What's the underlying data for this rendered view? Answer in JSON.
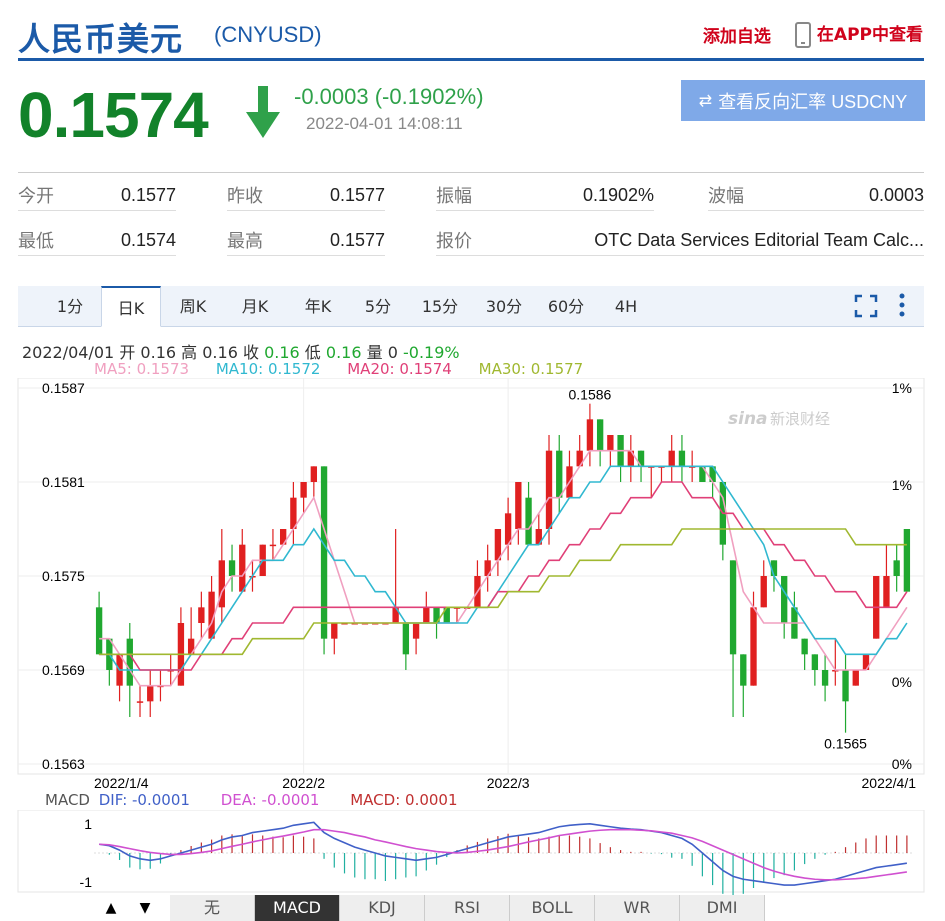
{
  "header": {
    "title": "人民币美元",
    "code": "(CNYUSD)",
    "add_watch": "添加自选",
    "app_view": "在APP中查看"
  },
  "quote": {
    "price": "0.1574",
    "change": "-0.0003 (-0.1902%)",
    "time": "2022-04-01 14:08:11",
    "reverse_button": "查看反向汇率 USDCNY"
  },
  "stats": {
    "row1": [
      {
        "label": "今开",
        "value": "0.1577"
      },
      {
        "label": "昨收",
        "value": "0.1577"
      },
      {
        "label": "振幅",
        "value": "0.1902%"
      },
      {
        "label": "波幅",
        "value": "0.0003"
      }
    ],
    "row2": [
      {
        "label": "最低",
        "value": "0.1574"
      },
      {
        "label": "最高",
        "value": "0.1577"
      },
      {
        "label": "报价",
        "value": "OTC Data Services Editorial Team Calc..."
      }
    ]
  },
  "period_tabs": [
    "1分",
    "日K",
    "周K",
    "月K",
    "年K",
    "5分",
    "15分",
    "30分",
    "60分",
    "4H"
  ],
  "active_tab": "日K",
  "ohlc_line": {
    "date": "2022/04/01",
    "open_label": "开",
    "open": "0.16",
    "high_label": "高",
    "high": "0.16",
    "close_label": "收",
    "close": "0.16",
    "low_label": "低",
    "low": "0.16",
    "vol_label": "量",
    "vol": "0",
    "change": "-0.19%"
  },
  "ma_legend": {
    "ma5": "MA5: 0.1573",
    "ma10": "MA10: 0.1572",
    "ma20": "MA20: 0.1574",
    "ma30": "MA30: 0.1577"
  },
  "colors": {
    "up": "#e02020",
    "down": "#20a830",
    "ma5": "#f0a0c0",
    "ma10": "#30b8d0",
    "ma20": "#e04078",
    "ma30": "#a0b830",
    "dif": "#4060c8",
    "dea": "#d050d0"
  },
  "chart_data": {
    "type": "candlestick",
    "y_ticks": [
      "0.1587",
      "0.1581",
      "0.1575",
      "0.1569",
      "0.1563"
    ],
    "ylim": [
      0.1563,
      0.1587
    ],
    "pct_ticks": [
      "1%",
      "1%",
      "0%",
      "0%"
    ],
    "x_ticks": [
      "2022/1/4",
      "2022/2",
      "2022/3",
      "2022/4/1"
    ],
    "max_label": "0.1586",
    "min_label": "0.1565",
    "candles": [
      [
        0.1573,
        0.157,
        0.1574,
        0.157
      ],
      [
        0.1571,
        0.1569,
        0.1571,
        0.1568
      ],
      [
        0.1568,
        0.157,
        0.157,
        0.1567
      ],
      [
        0.1571,
        0.1568,
        0.1572,
        0.1566
      ],
      [
        0.1567,
        0.1567,
        0.1568,
        0.1566
      ],
      [
        0.1567,
        0.1568,
        0.1569,
        0.1566
      ],
      [
        0.1568,
        0.1568,
        0.1569,
        0.1567
      ],
      [
        0.1569,
        0.1569,
        0.157,
        0.1568
      ],
      [
        0.1568,
        0.1572,
        0.1573,
        0.1568
      ],
      [
        0.157,
        0.1571,
        0.1573,
        0.157
      ],
      [
        0.1572,
        0.1573,
        0.1574,
        0.1571
      ],
      [
        0.1571,
        0.1574,
        0.1575,
        0.1571
      ],
      [
        0.1573,
        0.1576,
        0.1578,
        0.1572
      ],
      [
        0.1576,
        0.1575,
        0.1577,
        0.1574
      ],
      [
        0.1574,
        0.1577,
        0.1578,
        0.1574
      ],
      [
        0.1575,
        0.1575,
        0.1576,
        0.1574
      ],
      [
        0.1575,
        0.1577,
        0.1577,
        0.1575
      ],
      [
        0.1577,
        0.1577,
        0.1578,
        0.1576
      ],
      [
        0.1577,
        0.1578,
        0.1578,
        0.1577
      ],
      [
        0.1578,
        0.158,
        0.1581,
        0.1577
      ],
      [
        0.158,
        0.1581,
        0.1581,
        0.1579
      ],
      [
        0.1581,
        0.1582,
        0.1582,
        0.158
      ],
      [
        0.1582,
        0.1571,
        0.1582,
        0.157
      ],
      [
        0.1571,
        0.1572,
        0.1572,
        0.157
      ],
      [
        0.1572,
        0.1572,
        0.1572,
        0.1572
      ],
      [
        0.1572,
        0.1572,
        0.1572,
        0.1572
      ],
      [
        0.1572,
        0.1572,
        0.1572,
        0.1572
      ],
      [
        0.1572,
        0.1572,
        0.1572,
        0.1572
      ],
      [
        0.1572,
        0.1572,
        0.1572,
        0.1572
      ],
      [
        0.1572,
        0.1573,
        0.1578,
        0.1572
      ],
      [
        0.1572,
        0.157,
        0.1572,
        0.1569
      ],
      [
        0.1571,
        0.1572,
        0.1572,
        0.157
      ],
      [
        0.1572,
        0.1573,
        0.1574,
        0.1572
      ],
      [
        0.1573,
        0.1572,
        0.1573,
        0.1571
      ],
      [
        0.1573,
        0.1572,
        0.1573,
        0.1572
      ],
      [
        0.1573,
        0.1573,
        0.1573,
        0.1572
      ],
      [
        0.1573,
        0.1573,
        0.1573,
        0.1573
      ],
      [
        0.1573,
        0.1575,
        0.1576,
        0.1573
      ],
      [
        0.1575,
        0.1576,
        0.1577,
        0.1574
      ],
      [
        0.1576,
        0.1578,
        0.1578,
        0.1575
      ],
      [
        0.1577,
        0.1579,
        0.158,
        0.1576
      ],
      [
        0.1578,
        0.1581,
        0.1581,
        0.1577
      ],
      [
        0.158,
        0.1577,
        0.1581,
        0.1577
      ],
      [
        0.1577,
        0.1578,
        0.1579,
        0.1577
      ],
      [
        0.1578,
        0.1583,
        0.1584,
        0.1577
      ],
      [
        0.1583,
        0.158,
        0.1584,
        0.1579
      ],
      [
        0.158,
        0.1582,
        0.1583,
        0.158
      ],
      [
        0.1582,
        0.1583,
        0.1584,
        0.1582
      ],
      [
        0.1583,
        0.1585,
        0.1586,
        0.1582
      ],
      [
        0.1585,
        0.1583,
        0.1585,
        0.1582
      ],
      [
        0.1583,
        0.1584,
        0.1584,
        0.1582
      ],
      [
        0.1584,
        0.1582,
        0.1584,
        0.1581
      ],
      [
        0.1582,
        0.1583,
        0.1584,
        0.1581
      ],
      [
        0.1583,
        0.1582,
        0.1583,
        0.1581
      ],
      [
        0.1582,
        0.1582,
        0.1582,
        0.158
      ],
      [
        0.1582,
        0.1582,
        0.1582,
        0.1581
      ],
      [
        0.1582,
        0.1583,
        0.1584,
        0.1581
      ],
      [
        0.1583,
        0.1582,
        0.1584,
        0.1581
      ],
      [
        0.1582,
        0.1582,
        0.1583,
        0.1581
      ],
      [
        0.1582,
        0.1581,
        0.1582,
        0.1581
      ],
      [
        0.1582,
        0.1581,
        0.1582,
        0.158
      ],
      [
        0.1581,
        0.1577,
        0.1581,
        0.1576
      ],
      [
        0.1576,
        0.157,
        0.1576,
        0.1566
      ],
      [
        0.157,
        0.1568,
        0.157,
        0.1566
      ],
      [
        0.1568,
        0.1573,
        0.1574,
        0.1568
      ],
      [
        0.1573,
        0.1575,
        0.1576,
        0.1573
      ],
      [
        0.1576,
        0.1575,
        0.1576,
        0.1574
      ],
      [
        0.1575,
        0.1572,
        0.1575,
        0.1571
      ],
      [
        0.1573,
        0.1571,
        0.1574,
        0.1571
      ],
      [
        0.1571,
        0.157,
        0.1571,
        0.1569
      ],
      [
        0.157,
        0.1569,
        0.157,
        0.1568
      ],
      [
        0.1569,
        0.1568,
        0.157,
        0.1567
      ],
      [
        0.1569,
        0.1569,
        0.1571,
        0.1568
      ],
      [
        0.1569,
        0.1567,
        0.157,
        0.1565
      ],
      [
        0.1568,
        0.1569,
        0.1569,
        0.1568
      ],
      [
        0.1569,
        0.157,
        0.157,
        0.1569
      ],
      [
        0.1571,
        0.1575,
        0.1575,
        0.1571
      ],
      [
        0.1573,
        0.1575,
        0.1577,
        0.1573
      ],
      [
        0.1576,
        0.1575,
        0.1577,
        0.1574
      ],
      [
        0.1578,
        0.1574,
        0.1578,
        0.1574
      ]
    ],
    "ma5": [
      0.1571,
      0.1571,
      0.157,
      0.1569,
      0.1568,
      0.1568,
      0.1568,
      0.1568,
      0.1569,
      0.157,
      0.1571,
      0.1572,
      0.1574,
      0.1575,
      0.1575,
      0.1576,
      0.1576,
      0.1576,
      0.1577,
      0.1578,
      0.1579,
      0.158,
      0.1578,
      0.1576,
      0.1574,
      0.1572,
      0.1572,
      0.1572,
      0.1572,
      0.1572,
      0.1572,
      0.1572,
      0.1572,
      0.1572,
      0.1572,
      0.1572,
      0.1573,
      0.1574,
      0.1575,
      0.1576,
      0.1577,
      0.1578,
      0.1578,
      0.1579,
      0.158,
      0.158,
      0.1581,
      0.1582,
      0.1583,
      0.1583,
      0.1583,
      0.1583,
      0.1583,
      0.1582,
      0.1582,
      0.1582,
      0.1582,
      0.1582,
      0.1582,
      0.1582,
      0.1581,
      0.158,
      0.1577,
      0.1574,
      0.1573,
      0.1572,
      0.1572,
      0.1572,
      0.1572,
      0.1572,
      0.1571,
      0.157,
      0.1569,
      0.1569,
      0.1569,
      0.1569,
      0.157,
      0.1571,
      0.1572,
      0.1573
    ],
    "ma10": [
      0.157,
      0.157,
      0.1569,
      0.1569,
      0.1569,
      0.1569,
      0.1569,
      0.1569,
      0.1569,
      0.157,
      0.157,
      0.1571,
      0.1572,
      0.1573,
      0.1574,
      0.1575,
      0.1576,
      0.1576,
      0.1576,
      0.1577,
      0.1577,
      0.1578,
      0.1577,
      0.1576,
      0.1576,
      0.1575,
      0.1575,
      0.1574,
      0.1574,
      0.1573,
      0.1572,
      0.1572,
      0.1572,
      0.1572,
      0.1572,
      0.1572,
      0.1572,
      0.1573,
      0.1573,
      0.1574,
      0.1575,
      0.1576,
      0.1577,
      0.1577,
      0.1578,
      0.1579,
      0.158,
      0.158,
      0.1581,
      0.1581,
      0.1582,
      0.1582,
      0.1582,
      0.1582,
      0.1582,
      0.1582,
      0.1582,
      0.1582,
      0.1582,
      0.1582,
      0.1582,
      0.1581,
      0.158,
      0.1579,
      0.1578,
      0.1577,
      0.1575,
      0.1574,
      0.1573,
      0.1572,
      0.1571,
      0.1571,
      0.1571,
      0.157,
      0.157,
      0.157,
      0.157,
      0.1571,
      0.1571,
      0.1572
    ],
    "ma20": [
      0.157,
      0.157,
      0.157,
      0.157,
      0.1569,
      0.1569,
      0.1569,
      0.1569,
      0.1569,
      0.1569,
      0.157,
      0.157,
      0.157,
      0.1571,
      0.1571,
      0.1572,
      0.1572,
      0.1572,
      0.1572,
      0.1573,
      0.1573,
      0.1573,
      0.1573,
      0.1573,
      0.1573,
      0.1573,
      0.1573,
      0.1573,
      0.1573,
      0.1573,
      0.1573,
      0.1573,
      0.1573,
      0.1573,
      0.1573,
      0.1573,
      0.1573,
      0.1573,
      0.1573,
      0.1574,
      0.1574,
      0.1574,
      0.1575,
      0.1575,
      0.1576,
      0.1576,
      0.1577,
      0.1577,
      0.1578,
      0.1578,
      0.1579,
      0.1579,
      0.158,
      0.158,
      0.158,
      0.1581,
      0.1581,
      0.1581,
      0.158,
      0.158,
      0.158,
      0.1579,
      0.1579,
      0.1578,
      0.1578,
      0.1578,
      0.1577,
      0.1577,
      0.1576,
      0.1576,
      0.1575,
      0.1575,
      0.1574,
      0.1574,
      0.1574,
      0.1573,
      0.1573,
      0.1573,
      0.1573,
      0.1574
    ],
    "ma30": [
      0.157,
      0.157,
      0.157,
      0.157,
      0.157,
      0.157,
      0.157,
      0.157,
      0.157,
      0.157,
      0.157,
      0.157,
      0.157,
      0.157,
      0.157,
      0.1571,
      0.1571,
      0.1571,
      0.1571,
      0.1571,
      0.1571,
      0.1572,
      0.1572,
      0.1572,
      0.1572,
      0.1572,
      0.1572,
      0.1572,
      0.1572,
      0.1572,
      0.1572,
      0.1572,
      0.1572,
      0.1572,
      0.1573,
      0.1573,
      0.1573,
      0.1573,
      0.1573,
      0.1573,
      0.1574,
      0.1574,
      0.1574,
      0.1574,
      0.1575,
      0.1575,
      0.1575,
      0.1576,
      0.1576,
      0.1576,
      0.1576,
      0.1577,
      0.1577,
      0.1577,
      0.1577,
      0.1577,
      0.1577,
      0.1578,
      0.1578,
      0.1578,
      0.1578,
      0.1578,
      0.1578,
      0.1578,
      0.1578,
      0.1578,
      0.1578,
      0.1578,
      0.1578,
      0.1578,
      0.1578,
      0.1578,
      0.1578,
      0.1578,
      0.1577,
      0.1577,
      0.1577,
      0.1577,
      0.1577,
      0.1577
    ],
    "macd": {
      "y_ticks": [
        "1",
        "-1"
      ],
      "legend": {
        "name": "MACD",
        "dif": "DIF: -0.0001",
        "dea": "DEA: -0.0001",
        "macd": "MACD: 0.0001"
      },
      "dif": [
        0.3,
        0.25,
        0.1,
        -0.1,
        -0.2,
        -0.25,
        -0.2,
        -0.1,
        0.0,
        0.1,
        0.2,
        0.3,
        0.45,
        0.55,
        0.6,
        0.7,
        0.75,
        0.8,
        0.85,
        0.95,
        1.0,
        1.05,
        0.7,
        0.5,
        0.35,
        0.2,
        0.1,
        0.0,
        -0.1,
        -0.15,
        -0.2,
        -0.25,
        -0.2,
        -0.15,
        -0.05,
        0.05,
        0.15,
        0.25,
        0.35,
        0.45,
        0.55,
        0.6,
        0.65,
        0.7,
        0.8,
        0.9,
        0.95,
        0.98,
        1.0,
        0.95,
        0.9,
        0.85,
        0.82,
        0.8,
        0.75,
        0.7,
        0.6,
        0.5,
        0.3,
        0.0,
        -0.3,
        -0.6,
        -0.8,
        -0.9,
        -0.95,
        -1.0,
        -1.05,
        -1.1,
        -1.1,
        -1.05,
        -1.0,
        -0.95,
        -0.9,
        -0.8,
        -0.7,
        -0.6,
        -0.5,
        -0.45,
        -0.4,
        -0.35
      ],
      "dea": [
        0.3,
        0.28,
        0.22,
        0.15,
        0.08,
        0.02,
        -0.02,
        -0.05,
        -0.05,
        -0.02,
        0.02,
        0.07,
        0.15,
        0.23,
        0.3,
        0.38,
        0.45,
        0.52,
        0.58,
        0.65,
        0.72,
        0.8,
        0.8,
        0.75,
        0.7,
        0.62,
        0.55,
        0.45,
        0.38,
        0.3,
        0.22,
        0.15,
        0.1,
        0.05,
        0.02,
        0.0,
        0.02,
        0.06,
        0.1,
        0.16,
        0.22,
        0.3,
        0.38,
        0.45,
        0.52,
        0.6,
        0.65,
        0.7,
        0.75,
        0.78,
        0.8,
        0.8,
        0.8,
        0.78,
        0.76,
        0.72,
        0.68,
        0.6,
        0.52,
        0.4,
        0.25,
        0.1,
        -0.05,
        -0.2,
        -0.35,
        -0.5,
        -0.62,
        -0.72,
        -0.8,
        -0.86,
        -0.9,
        -0.92,
        -0.92,
        -0.9,
        -0.88,
        -0.85,
        -0.8,
        -0.75,
        -0.7,
        -0.65
      ]
    }
  },
  "bottom_tabs": [
    "无",
    "MACD",
    "KDJ",
    "RSI",
    "BOLL",
    "WR",
    "DMI"
  ],
  "active_indicator": "MACD",
  "nav": {
    "up": "▲",
    "down": "▼"
  }
}
